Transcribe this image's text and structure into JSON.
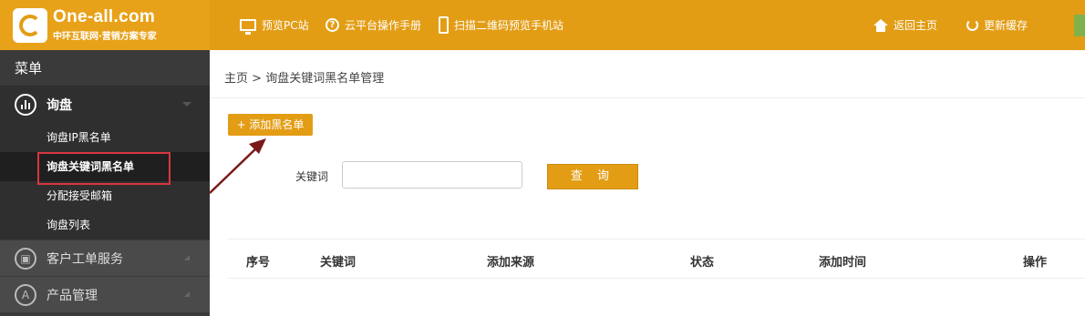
{
  "logo": {
    "title": "One-all.com",
    "subtitle": "中环互联网·营销方案专家"
  },
  "topnav": {
    "preview_pc": "预览PC站",
    "manual": "云平台操作手册",
    "qr_preview": "扫描二维码预览手机站",
    "home": "返回主页",
    "refresh_cache": "更新缓存"
  },
  "sidebar": {
    "header": "菜单",
    "groups": [
      {
        "label": "询盘",
        "icon": "bar-chart-icon",
        "expanded": true
      },
      {
        "label": "客户工单服务",
        "icon": "briefcase-icon",
        "expanded": false
      },
      {
        "label": "产品管理",
        "icon": "letter-a-icon",
        "icon_glyph": "A",
        "expanded": false
      }
    ],
    "subitems": [
      "询盘IP黑名单",
      "询盘关键词黑名单",
      "分配接受邮箱",
      "询盘列表"
    ],
    "selected_subitem": "询盘关键词黑名单"
  },
  "breadcrumb": {
    "home": "主页",
    "separator": ">",
    "current": "询盘关键词黑名单管理"
  },
  "add_button": "+ 添加黑名单",
  "search": {
    "label": "关键词",
    "value": "",
    "button": "查 询"
  },
  "table": {
    "columns": [
      "序号",
      "关键词",
      "添加来源",
      "状态",
      "添加时间",
      "操作"
    ],
    "rows": []
  },
  "colors": {
    "accent": "#e39d15",
    "sidebar": "#3a3a3a",
    "highlight": "#d9363e",
    "arrow": "#7a1a1a"
  }
}
